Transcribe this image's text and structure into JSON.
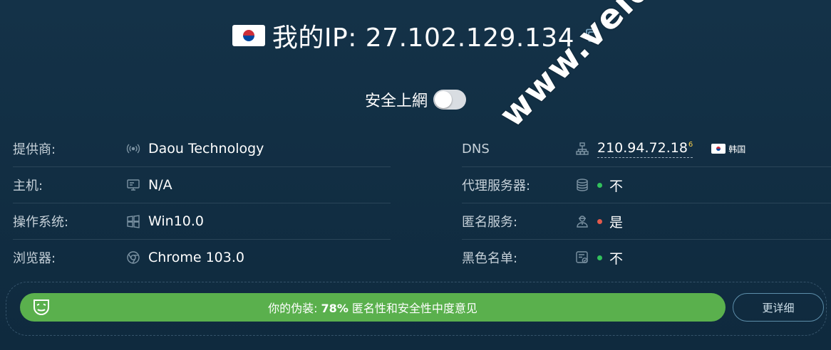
{
  "header": {
    "title": "我的IP: 27.102.129.134",
    "flag_icon": "south-korea-flag",
    "copy_icon": "copy-icon"
  },
  "secure": {
    "label": "安全上網",
    "enabled": false
  },
  "left_rows": [
    {
      "label": "提供商:",
      "icon": "broadcast-icon",
      "value": "Daou Technology"
    },
    {
      "label": "主机:",
      "icon": "monitor-icon",
      "value": "N/A"
    },
    {
      "label": "操作系统:",
      "icon": "windows-icon",
      "value": "Win10.0"
    },
    {
      "label": "浏览器:",
      "icon": "chrome-icon",
      "value": "Chrome 103.0"
    }
  ],
  "right_rows": {
    "dns": {
      "label": "DNS",
      "icon": "network-icon",
      "value": "210.94.72.18",
      "sup": "6",
      "country": "韩国"
    },
    "proxy": {
      "label": "代理服务器:",
      "icon": "database-icon",
      "status": "green",
      "value": "不"
    },
    "anonymous": {
      "label": "匿名服务:",
      "icon": "agent-icon",
      "status": "red",
      "value": "是"
    },
    "blacklist": {
      "label": "黑色名单:",
      "icon": "list-check-icon",
      "status": "green",
      "value": "不"
    }
  },
  "disguise": {
    "prefix": "你的伪装: ",
    "percent_text": "78%",
    "suffix": " 匿名性和安全性中度意见",
    "percent": 0.78,
    "bar_color": "#5ab04d",
    "icon": "mask-icon"
  },
  "details_button": "更详细",
  "watermark": "www.veidc.com",
  "colors": {
    "background": "#143248",
    "green": "#32c15c",
    "red": "#e45a4c"
  }
}
